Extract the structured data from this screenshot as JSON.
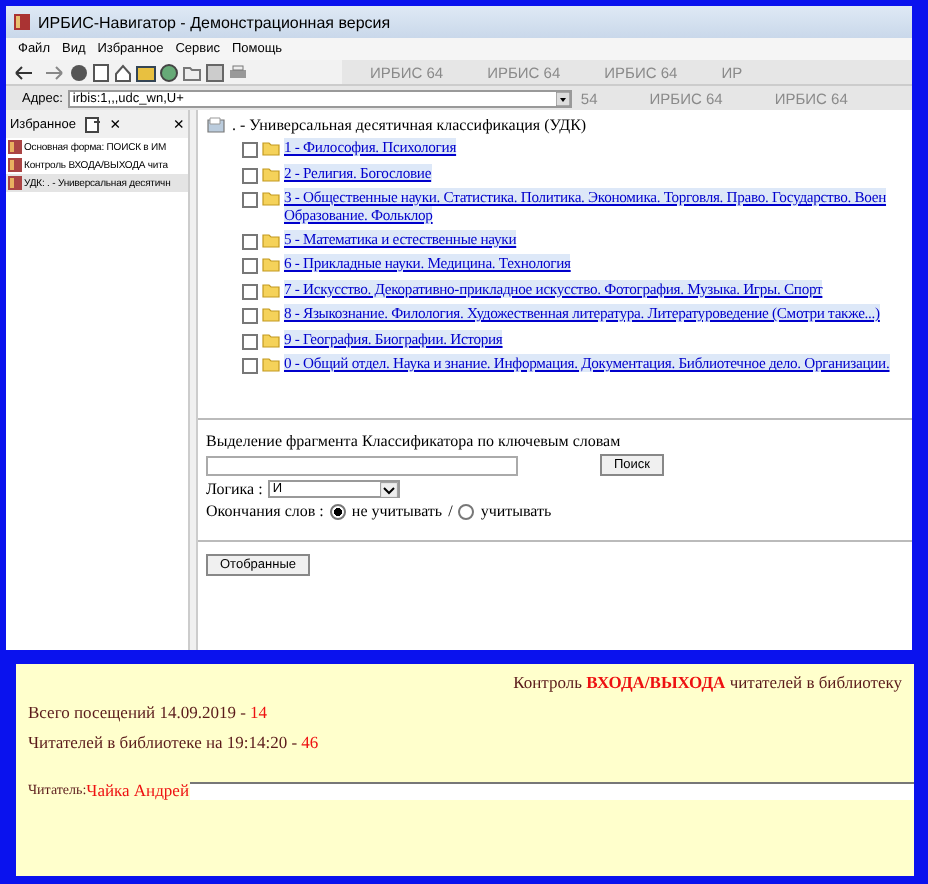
{
  "window": {
    "title": "ИРБИС-Навигатор - Демонстрационная версия"
  },
  "menu": [
    "Файл",
    "Вид",
    "Избранное",
    "Сервис",
    "Помощь"
  ],
  "branding": [
    [
      "ИРБИС 64",
      "ИРБИС 64",
      "ИРБИС 64",
      "ИР"
    ],
    [
      "54",
      "ИРБИС 64",
      "ИРБИС 64"
    ]
  ],
  "address": {
    "label": "Адрес:",
    "value": "irbis:1,,,udc_wn,U+"
  },
  "sidebar": {
    "title": "Избранное",
    "close": "×",
    "items": [
      {
        "label": "Основная форма: ПОИСК в ИМ",
        "selected": false
      },
      {
        "label": "Контроль ВХОДА/ВЫХОДА чита",
        "selected": false
      },
      {
        "label": "УДК: . - Универсальная десятичн",
        "selected": true
      }
    ]
  },
  "tree": {
    "root": ". - Универсальная десятичная классификация (УДК)",
    "children": [
      {
        "lines": [
          "1 - Философия. Психология"
        ],
        "checked": false
      },
      {
        "lines": [
          "2 - Религия. Богословие"
        ],
        "checked": false
      },
      {
        "lines": [
          "3 - Общественные науки. Статистика. Политика. Экономика. Торговля. Право. Государство. Воен",
          "Образование. Фольклор"
        ],
        "checked": false
      },
      {
        "lines": [
          "5 - Математика и естественные науки"
        ],
        "checked": false
      },
      {
        "lines": [
          "6 - Прикладные науки. Медицина. Технология"
        ],
        "checked": false
      },
      {
        "lines": [
          "7 - Искусство. Декоративно-прикладное искусство. Фотография. Музыка. Игры. Спорт"
        ],
        "checked": false
      },
      {
        "lines": [
          "8 - Языкознание. Филология. Художественная литература. Литературоведение (Смотри также...)"
        ],
        "checked": false
      },
      {
        "lines": [
          "9 - География. Биографии. История"
        ],
        "checked": false
      },
      {
        "lines": [
          "0 - Общий отдел. Наука и знание. Информация. Документация. Библиотечное дело. Организации."
        ],
        "checked": false
      }
    ]
  },
  "search": {
    "label": "Выделение фрагмента Классификатора по ключевым словам",
    "button": "Поиск",
    "logic_label": "Логика :",
    "logic_value": "И",
    "endings_label": "Окончания слов :",
    "endings": [
      {
        "label": "не учитывать",
        "selected": true
      },
      {
        "label": "учитывать",
        "selected": false
      }
    ],
    "separator": "/"
  },
  "selected_button": "Отобранные",
  "panel": {
    "title": "Контроль **ВХОДА/ВЫХОДА** читателей в библиотеку",
    "visits": {
      "label": "Всего посещений 14.09.2019 -",
      "value": "14"
    },
    "present": {
      "label": "Читателей в библиотеке на 19:14:20 -",
      "value": "46"
    },
    "reader_label": "Читатель:",
    "reader_name": "Чайка Андрей"
  }
}
